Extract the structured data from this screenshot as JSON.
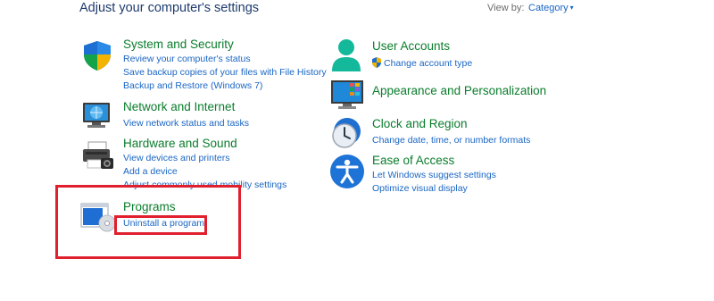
{
  "header": {
    "title": "Adjust your computer's settings",
    "view_by_label": "View by:",
    "view_by_value": "Category"
  },
  "categories": [
    {
      "title": "System and Security",
      "icon": "shield-icon",
      "links": [
        "Review your computer's status",
        "Save backup copies of your files with File History",
        "Backup and Restore (Windows 7)"
      ]
    },
    {
      "title": "Network and Internet",
      "icon": "network-icon",
      "links": [
        "View network status and tasks"
      ]
    },
    {
      "title": "Hardware and Sound",
      "icon": "printer-icon",
      "links": [
        "View devices and printers",
        "Add a device",
        "Adjust commonly used mobility settings"
      ]
    },
    {
      "title": "Programs",
      "icon": "programs-icon",
      "links": [
        "Uninstall a program"
      ]
    },
    {
      "title": "User Accounts",
      "icon": "user-icon",
      "links": [
        "Change account type"
      ]
    },
    {
      "title": "Appearance and Personalization",
      "icon": "monitor-icon",
      "links": []
    },
    {
      "title": "Clock and Region",
      "icon": "clock-icon",
      "links": [
        "Change date, time, or number formats"
      ]
    },
    {
      "title": "Ease of Access",
      "icon": "accessibility-icon",
      "links": [
        "Let Windows suggest settings",
        "Optimize visual display"
      ]
    }
  ],
  "colors": {
    "category_title": "#0a7d2c",
    "link": "#1a66c4",
    "highlight": "#e0202e"
  }
}
